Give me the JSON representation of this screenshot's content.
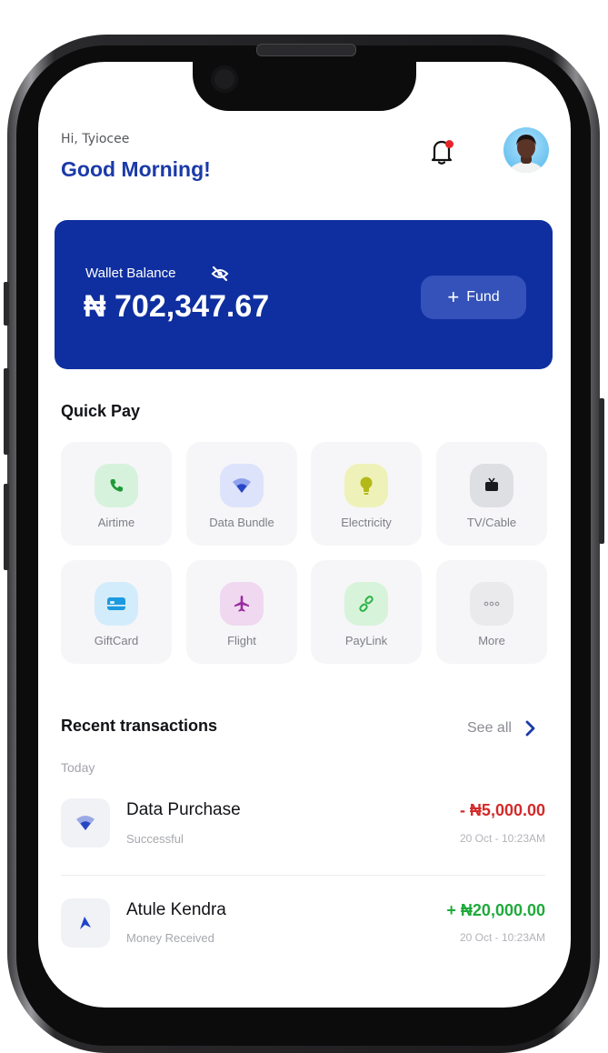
{
  "header": {
    "greeting": "Hi, Tyiocee",
    "salutation": "Good Morning!"
  },
  "wallet": {
    "label": "Wallet Balance",
    "amount": "₦ 702,347.67",
    "fund_label": "Fund"
  },
  "quick_pay": {
    "title": "Quick Pay",
    "items": [
      {
        "label": "Airtime",
        "icon": "phone-icon",
        "bg": "#d7f2dc",
        "fg": "#1f9a3a"
      },
      {
        "label": "Data Bundle",
        "icon": "wifi-icon",
        "bg": "#dde3fb",
        "fg": "#2846c4"
      },
      {
        "label": "Electricity",
        "icon": "bulb-icon",
        "bg": "#eef2b9",
        "fg": "#b4b91a"
      },
      {
        "label": "TV/Cable",
        "icon": "tv-icon",
        "bg": "#dedfe2",
        "fg": "#1b1b1e"
      },
      {
        "label": "GiftCard",
        "icon": "card-icon",
        "bg": "#d3ecfb",
        "fg": "#1b9adf"
      },
      {
        "label": "Flight",
        "icon": "plane-icon",
        "bg": "#f0d8f0",
        "fg": "#9a2ba0"
      },
      {
        "label": "PayLink",
        "icon": "link-icon",
        "bg": "#d7f3da",
        "fg": "#27b244"
      },
      {
        "label": "More",
        "icon": "more-icon",
        "bg": "#eaeaec",
        "fg": "#8a8b90"
      }
    ]
  },
  "transactions": {
    "title": "Recent transactions",
    "see_all": "See all",
    "group_label": "Today",
    "items": [
      {
        "title": "Data Purchase",
        "status": "Successful",
        "amount": "- ₦5,000.00",
        "date": "20 Oct - 10:23AM",
        "amount_color": "#d32a2a",
        "icon": "wifi-icon"
      },
      {
        "title": "Atule Kendra",
        "status": "Money Received",
        "amount": "+ ₦20,000.00",
        "date": "20 Oct - 10:23AM",
        "amount_color": "#1faa3c",
        "icon": "send-icon"
      }
    ]
  },
  "colors": {
    "brand": "#1a3aa8",
    "wallet_bg": "#0f2fa0",
    "notification_dot": "#e5252a"
  }
}
